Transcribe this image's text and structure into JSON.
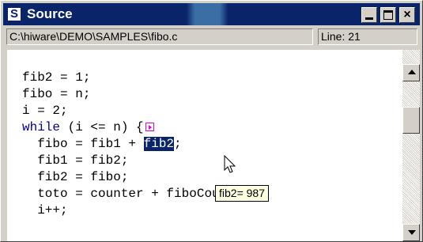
{
  "window": {
    "title": "Source",
    "icon_letter": "S",
    "close_glyph": "×",
    "title_color": "#0a246a"
  },
  "path_bar": {
    "path": "C:\\hiware\\DEMO\\SAMPLES\\fibo.c",
    "line_label": "Line: 21"
  },
  "code": {
    "lines": [
      [
        "fib2 = 1;"
      ],
      [
        "fibo = n;"
      ],
      [
        "i = 2;"
      ],
      [
        "while",
        " (i <= n) {"
      ],
      [
        "  fibo = fib1 + ",
        "fib2",
        ";"
      ],
      [
        "  fib1 = fib2;"
      ],
      [
        "  fib2 = fibo;"
      ],
      [
        "  toto = counter + fiboCount;"
      ],
      [
        "  i++;"
      ]
    ],
    "keyword_color": "#0000a0"
  },
  "tooltip": {
    "text": "fib2= 987"
  },
  "icons": {
    "app": "source-window-icon",
    "breakpoint": "execution-marker-icon",
    "cursor": "mouse-pointer-icon"
  }
}
